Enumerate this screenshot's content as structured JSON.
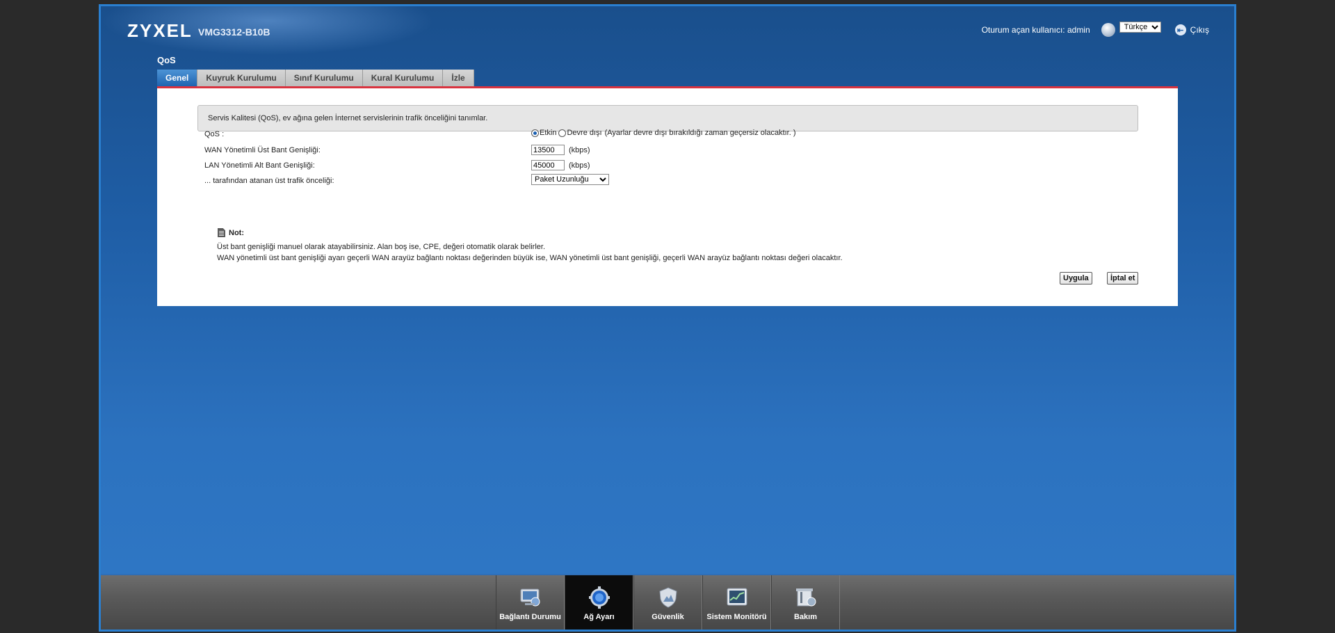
{
  "header": {
    "brand": "ZYXEL",
    "model": "VMG3312-B10B",
    "user_label": "Oturum açan kullanıcı: admin",
    "language": "Türkçe",
    "logout_label": "Çıkış"
  },
  "page": {
    "title": "QoS",
    "tabs": [
      {
        "label": "Genel",
        "active": true
      },
      {
        "label": "Kuyruk Kurulumu",
        "active": false
      },
      {
        "label": "Sınıf Kurulumu",
        "active": false
      },
      {
        "label": "Kural Kurulumu",
        "active": false
      },
      {
        "label": "İzle",
        "active": false
      }
    ]
  },
  "form": {
    "description": "Servis Kalitesi (QoS), ev ağına gelen İnternet servislerinin trafik önceliğini tanımlar.",
    "qos_label": "QoS :",
    "qos_enabled_label": "Etkin",
    "qos_disabled_label": "Devre dışı",
    "qos_note": "(Ayarlar devre dışı bırakıldığı zaman geçersiz olacaktır. )",
    "qos_selected": "Etkin",
    "wan_label": "WAN Yönetimli Üst Bant Genişliği:",
    "wan_value": "13500",
    "wan_unit": "(kbps)",
    "lan_label": "LAN Yönetimli Alt Bant Genişliği:",
    "lan_value": "45000",
    "lan_unit": "(kbps)",
    "priority_label": "... tarafından atanan üst trafik önceliği:",
    "priority_value": "Paket Uzunluğu"
  },
  "note": {
    "heading": "Not:",
    "line1": "Üst bant genişliği manuel olarak atayabilirsiniz. Alan boş ise, CPE, değeri otomatik olarak belirler.",
    "line2": "WAN yönetimli üst bant genişliği ayarı geçerli WAN arayüz bağlantı noktası değerinden büyük ise, WAN yönetimli üst bant genişliği, geçerli WAN arayüz bağlantı noktası değeri olacaktır."
  },
  "buttons": {
    "apply": "Uygula",
    "cancel": "İptal et"
  },
  "bottom_nav": [
    {
      "label": "Bağlantı Durumu",
      "icon": "connection-status-icon",
      "active": false
    },
    {
      "label": "Ağ Ayarı",
      "icon": "network-settings-gear-icon",
      "active": true
    },
    {
      "label": "Güvenlik",
      "icon": "security-shield-icon",
      "active": false
    },
    {
      "label": "Sistem Monitörü",
      "icon": "system-monitor-icon",
      "active": false
    },
    {
      "label": "Bakım",
      "icon": "maintenance-icon",
      "active": false
    }
  ],
  "colors": {
    "accent_red": "#d9333f",
    "active_tab": "#1f64b0",
    "background_blue": "#2c72bf"
  }
}
